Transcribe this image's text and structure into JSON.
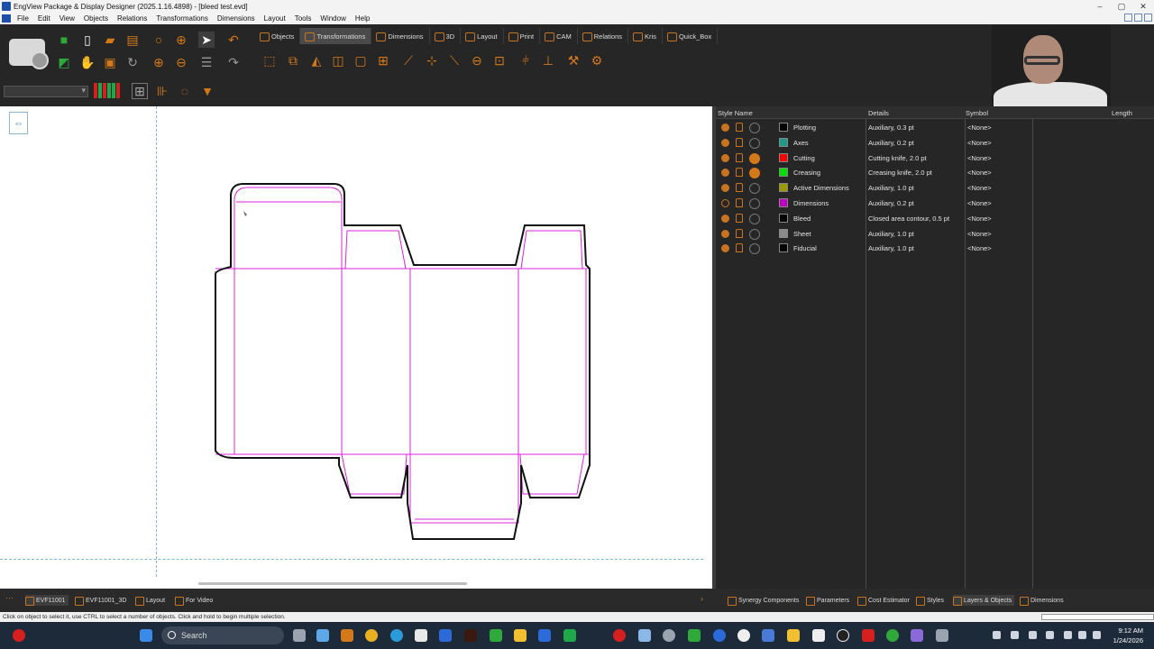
{
  "window": {
    "title": "EngView Package & Display Designer (2025.1.16.4898) - [bleed test.evd]",
    "controls": [
      "–",
      "▢",
      "✕"
    ]
  },
  "menu": [
    "File",
    "Edit",
    "View",
    "Objects",
    "Relations",
    "Transformations",
    "Dimensions",
    "Layout",
    "Tools",
    "Window",
    "Help"
  ],
  "toolbar": {
    "tabs": [
      "Objects",
      "Transformations",
      "Dimensions",
      "3D",
      "Layout",
      "Print",
      "CAM",
      "Relations",
      "Kris",
      "Quick_Box"
    ],
    "active_tab": "Transformations",
    "colors": [
      "#d62020",
      "#1fa84a",
      "#d62020",
      "#1fa84a",
      "#1fa84a",
      "#d62020"
    ]
  },
  "styles": {
    "headers": {
      "name": "Style Name",
      "details": "Details",
      "symbol": "Symbol",
      "length": "Length"
    },
    "rows": [
      {
        "name": "Plotting",
        "details": "Auxiliary, 0.3 pt",
        "symbol": "<None>",
        "color": "#000000",
        "visible": true,
        "dot": false
      },
      {
        "name": "Axes",
        "details": "Auxiliary, 0.2 pt",
        "symbol": "<None>",
        "color": "#1f9a8a",
        "visible": true,
        "dot": false
      },
      {
        "name": "Cutting",
        "details": "Cutting knife, 2.0 pt",
        "symbol": "<None>",
        "color": "#ff0000",
        "visible": true,
        "dot": true
      },
      {
        "name": "Creasing",
        "details": "Creasing knife, 2.0 pt",
        "symbol": "<None>",
        "color": "#00e000",
        "visible": true,
        "dot": true
      },
      {
        "name": "Active Dimensions",
        "details": "Auxiliary, 1.0 pt",
        "symbol": "<None>",
        "color": "#9a9a00",
        "visible": true,
        "dot": false
      },
      {
        "name": "Dimensions",
        "details": "Auxiliary, 0.2 pt",
        "symbol": "<None>",
        "color": "#c000c0",
        "visible": false,
        "dot": false
      },
      {
        "name": "Bleed",
        "details": "Closed area contour, 0.5 pt",
        "symbol": "<None>",
        "color": "#000000",
        "visible": true,
        "dot": false
      },
      {
        "name": "Sheet",
        "details": "Auxiliary, 1.0 pt",
        "symbol": "<None>",
        "color": "#8a8a8a",
        "visible": true,
        "dot": false
      },
      {
        "name": "Fiducial",
        "details": "Auxiliary, 1.0 pt",
        "symbol": "<None>",
        "color": "#000000",
        "visible": true,
        "dot": false
      }
    ]
  },
  "document_tabs": [
    "EVF11001",
    "EVF11001_3D",
    "Layout",
    "For Video"
  ],
  "panel_tabs": [
    "Synergy Components",
    "Parameters",
    "Cost Estimator",
    "Styles",
    "Layers & Objects",
    "Dimensions"
  ],
  "active_panel_tab": "Layers & Objects",
  "status": "Click on object to select it, use CTRL to select a number of objects. Click and hold to begin multiple selection.",
  "taskbar": {
    "search_placeholder": "Search",
    "time": "9:12 AM",
    "date": "1/24/2026"
  }
}
